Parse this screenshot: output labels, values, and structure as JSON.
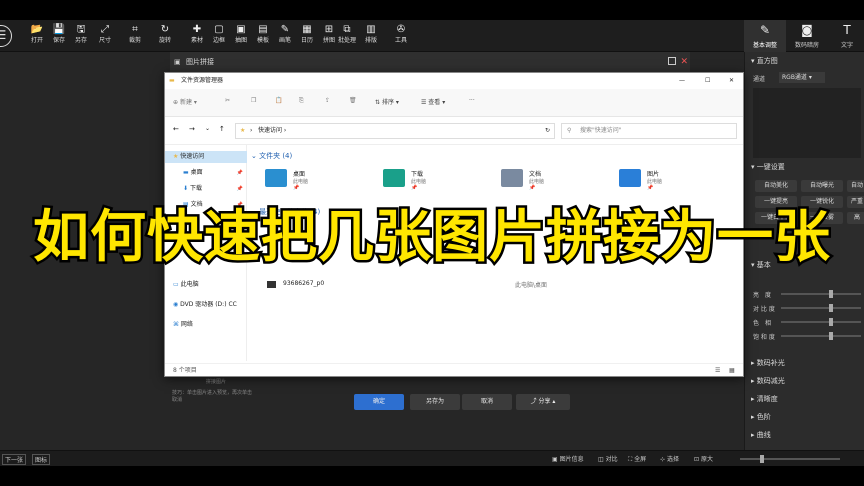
{
  "toolbar": {
    "items": [
      {
        "label": "打开",
        "icon": "folder-open-icon"
      },
      {
        "label": "保存",
        "icon": "save-icon"
      },
      {
        "label": "另存",
        "icon": "save-as-icon"
      },
      {
        "label": "尺寸",
        "icon": "resize-icon"
      },
      {
        "label": "裁剪",
        "icon": "crop-icon"
      },
      {
        "label": "旋转",
        "icon": "rotate-icon"
      },
      {
        "label": "素材",
        "icon": "material-icon"
      },
      {
        "label": "边框",
        "icon": "border-icon"
      },
      {
        "label": "抽图",
        "icon": "picture-icon"
      },
      {
        "label": "模板",
        "icon": "template-icon"
      },
      {
        "label": "画笔",
        "icon": "brush-icon"
      },
      {
        "label": "日历",
        "icon": "calendar-icon"
      },
      {
        "label": "拼图",
        "icon": "collage-icon"
      },
      {
        "label": "批处理",
        "icon": "batch-icon"
      },
      {
        "label": "排版",
        "icon": "layout-icon"
      },
      {
        "label": "工具",
        "icon": "tools-icon"
      }
    ],
    "right_tabs": [
      {
        "label": "基本调整",
        "icon": "adjust-icon"
      },
      {
        "label": "数码暗房",
        "icon": "camera-icon"
      },
      {
        "label": "文字",
        "icon": "text-icon"
      }
    ]
  },
  "panel_title": "图片拼接",
  "right_panel": {
    "histogram": "直方图",
    "channel_label": "通道",
    "channel_value": "RGB通道",
    "one_click": "一键设置",
    "buttons": [
      "自动美化",
      "自动曝光",
      "自动",
      "一键提亮",
      "一键锐化",
      "严重",
      "一键白平衡",
      "一键去雾",
      "高"
    ],
    "basic": "基本",
    "sliders": [
      "亮　度",
      "对 比 度",
      "色　相",
      "饱 和 度"
    ],
    "sections": [
      "数码补光",
      "数码减光",
      "清晰度",
      "色阶",
      "曲线"
    ]
  },
  "dialog": {
    "tip": "技巧：单击图片进入预览，再次单击取消",
    "tip2": "拼接图片",
    "confirm": "确定",
    "save_as": "另存为",
    "cancel": "取消",
    "share": "分享"
  },
  "explorer": {
    "title": "文件资源管理器",
    "cmd": {
      "new": "新建",
      "sort": "排序",
      "view": "查看"
    },
    "address": "快速访问",
    "search_placeholder": "搜索\"快速访问\"",
    "nav": [
      {
        "label": "快速访问",
        "sel": true
      },
      {
        "label": "桌面"
      },
      {
        "label": "下载"
      },
      {
        "label": "文档"
      },
      {
        "label": "此电脑"
      },
      {
        "label": "DVD 驱动器 (D:) CC"
      },
      {
        "label": "网络"
      }
    ],
    "folders_header": "文件夹 (4)",
    "folders": [
      {
        "name": "桌面",
        "sub": "此电脑",
        "color": "#2a8fd0"
      },
      {
        "name": "下载",
        "sub": "此电脑",
        "color": "#1aa08a"
      },
      {
        "name": "文档",
        "sub": "此电脑",
        "color": "#7a8aa0"
      },
      {
        "name": "图片",
        "sub": "此电脑",
        "color": "#2a7fd8"
      }
    ],
    "recent_header": "最近使用的文件 (4)",
    "recent_file": "93686267_p0",
    "recent_path": "此电脑\\桌面",
    "status": "8 个项目"
  },
  "status_bar": {
    "prev": "下一张",
    "browse": "图标",
    "info": "图片信息",
    "compare": "对比",
    "fullscreen": "全屏",
    "select": "选择",
    "zoom": "原大"
  },
  "overlay_text": "如何快速把几张图片拼接为一张"
}
